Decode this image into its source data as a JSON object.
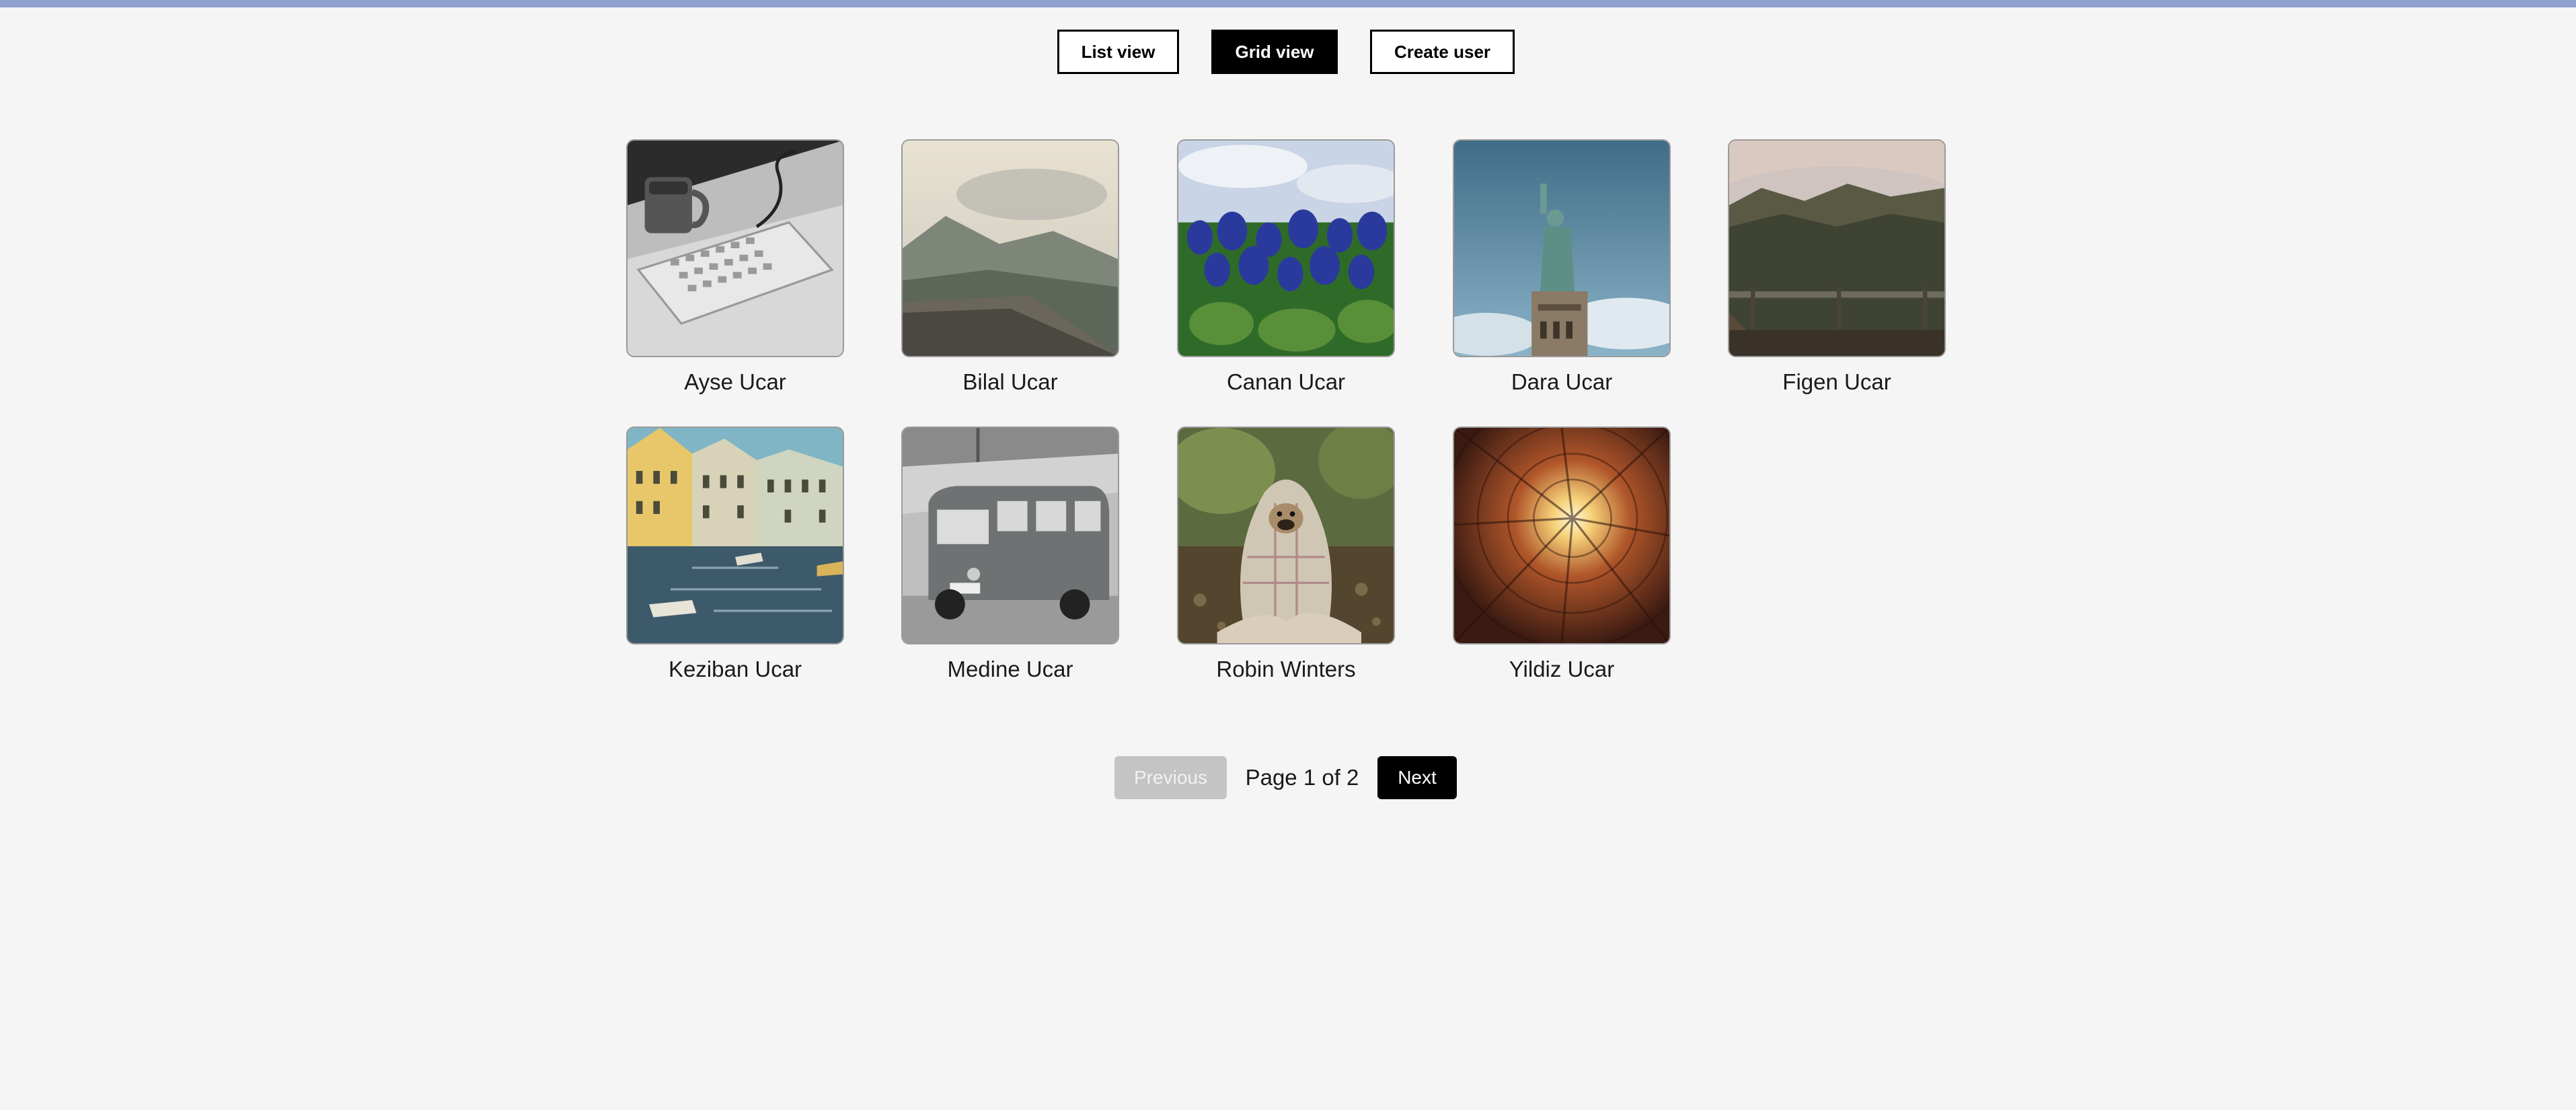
{
  "toolbar": {
    "list_view": "List view",
    "grid_view": "Grid view",
    "create_user": "Create user",
    "active_view": "grid"
  },
  "users": [
    {
      "name": "Ayse Ucar",
      "photo": "coffee-mug-keyboard-photo"
    },
    {
      "name": "Bilal Ucar",
      "photo": "mountain-valley-photo"
    },
    {
      "name": "Canan Ucar",
      "photo": "bluebonnet-flowers-photo"
    },
    {
      "name": "Dara Ucar",
      "photo": "statue-of-liberty-photo"
    },
    {
      "name": "Figen Ucar",
      "photo": "misty-forest-bridge-photo"
    },
    {
      "name": "Keziban Ucar",
      "photo": "canal-houses-photo"
    },
    {
      "name": "Medine Ucar",
      "photo": "vintage-van-photo"
    },
    {
      "name": "Robin Winters",
      "photo": "pug-in-blanket-photo"
    },
    {
      "name": "Yildiz Ucar",
      "photo": "building-courtyard-sky-photo"
    }
  ],
  "pagination": {
    "previous": "Previous",
    "page_label": "Page 1 of 2",
    "next": "Next",
    "current_page": 1,
    "total_pages": 2,
    "previous_disabled": true
  },
  "colors": {
    "background": "#f5f5f5",
    "top_bar": "#8e9fd0",
    "primary": "#000000",
    "disabled": "#c4c4c4"
  }
}
